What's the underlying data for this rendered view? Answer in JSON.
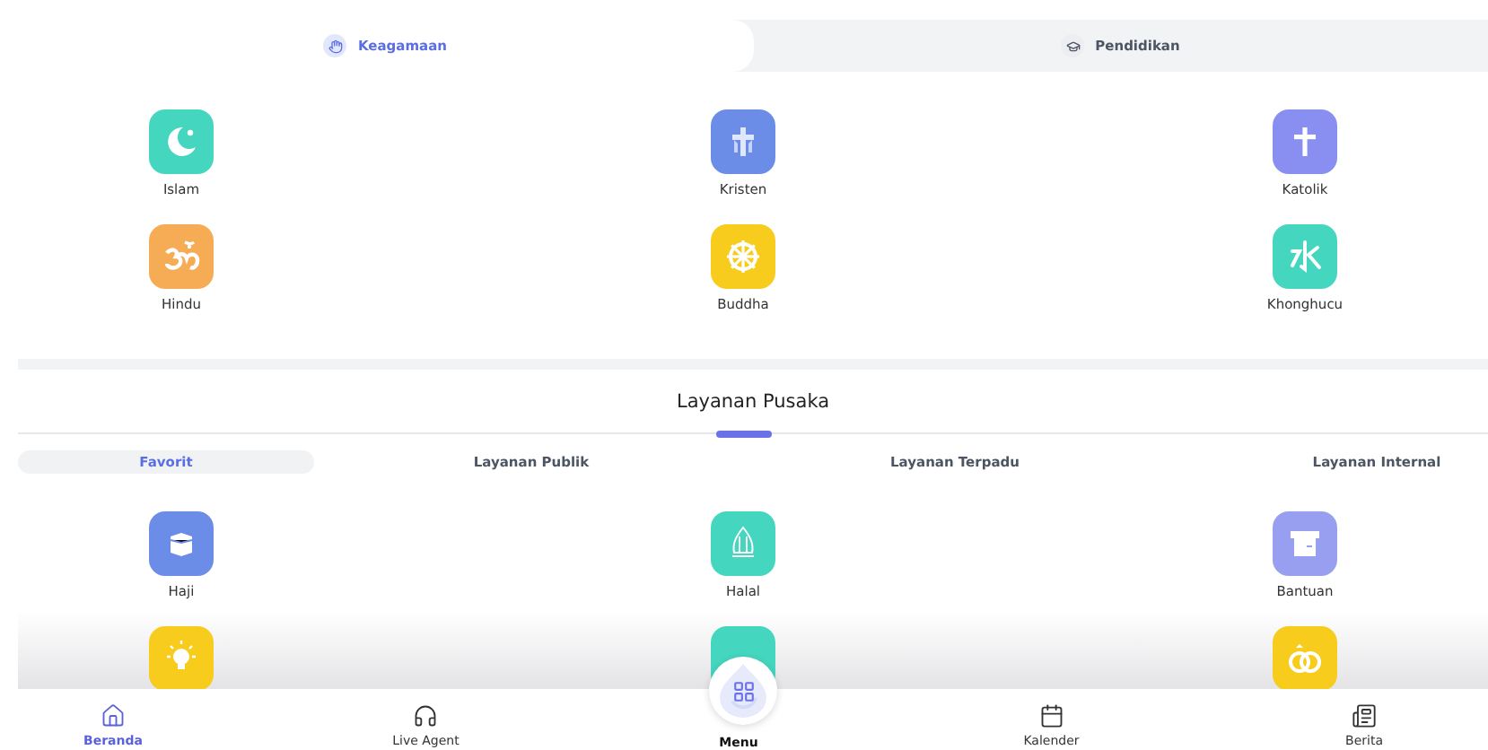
{
  "category_tabs": [
    {
      "label": "Keagamaan",
      "selected": true
    },
    {
      "label": "Pendidikan",
      "selected": false
    }
  ],
  "religion_items": [
    {
      "label": "Islam",
      "color": "#45d6c0"
    },
    {
      "label": "Kristen",
      "color": "#6b8de8"
    },
    {
      "label": "Katolik",
      "color": "#888ff0"
    },
    {
      "label": "Hindu",
      "color": "#f6ab55"
    },
    {
      "label": "Buddha",
      "color": "#f8cc1c"
    },
    {
      "label": "Khonghucu",
      "color": "#45d6c0"
    }
  ],
  "services": {
    "title": "Layanan Pusaka",
    "tabs": [
      {
        "label": "Favorit",
        "selected": true
      },
      {
        "label": "Layanan Publik",
        "selected": false
      },
      {
        "label": "Layanan Terpadu",
        "selected": false
      },
      {
        "label": "Layanan Internal",
        "selected": false
      }
    ],
    "items": [
      {
        "label": "Haji",
        "color": "#6b8de8"
      },
      {
        "label": "Halal",
        "color": "#45d6c0"
      },
      {
        "label": "Bantuan",
        "color": "#999ff0"
      },
      {
        "color": "#f8cc1c"
      },
      {
        "color": "#45d6c0"
      },
      {
        "color": "#f8cc1c"
      }
    ]
  },
  "bottom_nav": [
    {
      "label": "Beranda",
      "kind": "tab",
      "selected": true
    },
    {
      "label": "Live Agent",
      "kind": "tab",
      "selected": false
    },
    {
      "label": "Menu",
      "kind": "center",
      "selected": false
    },
    {
      "label": "Kalender",
      "kind": "tab",
      "selected": false
    },
    {
      "label": "Berita",
      "kind": "tab",
      "selected": false
    }
  ]
}
